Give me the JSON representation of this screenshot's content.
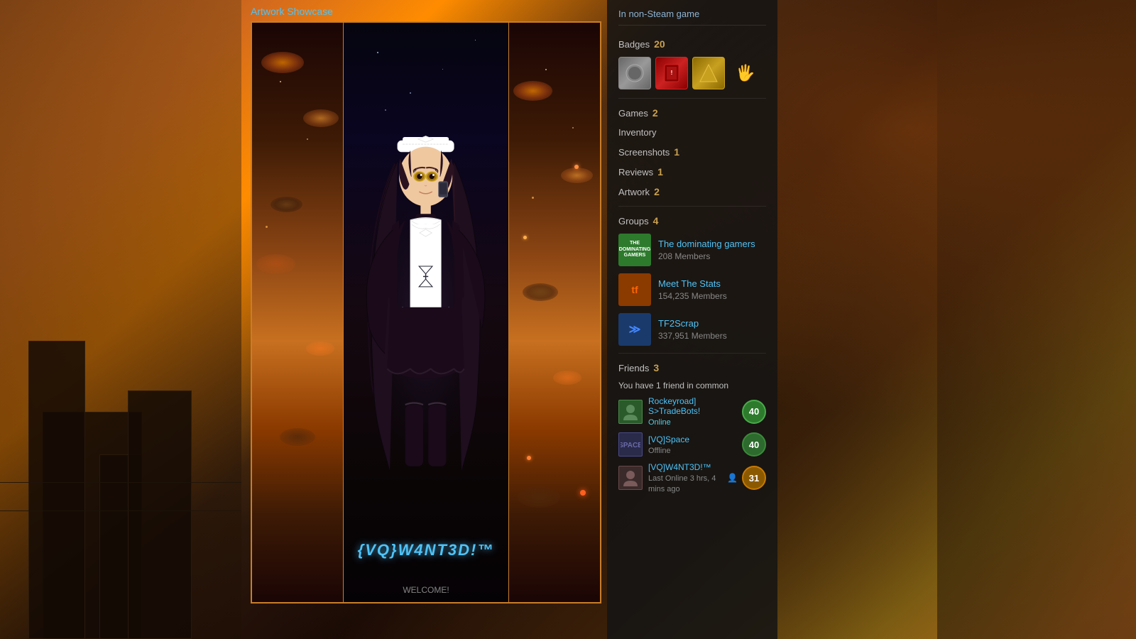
{
  "status": {
    "label": "In non-Steam game"
  },
  "showcase": {
    "title": "Artwork Showcase",
    "username": "{VQ}W4NT3D!™",
    "welcome": "WELCOME!"
  },
  "stats": {
    "badges_label": "Badges",
    "badges_count": "20",
    "games_label": "Games",
    "games_count": "2",
    "inventory_label": "Inventory",
    "screenshots_label": "Screenshots",
    "screenshots_count": "1",
    "reviews_label": "Reviews",
    "reviews_count": "1",
    "artwork_label": "Artwork",
    "artwork_count": "2"
  },
  "groups": {
    "label": "Groups",
    "count": "4",
    "items": [
      {
        "name": "The dominating gamers",
        "members": "208 Members",
        "icon_text": "THE\nDOMINATING\nGAMERS"
      },
      {
        "name": "Meet The Stats",
        "members": "154,235 Members",
        "icon_text": "tf"
      },
      {
        "name": "TF2Scrap",
        "members": "337,951 Members",
        "icon_text": "≫"
      }
    ]
  },
  "friends": {
    "label": "Friends",
    "count": "3",
    "common_text": "You have",
    "common_count": "1 friend",
    "common_suffix": "in common",
    "items": [
      {
        "name": "Rockeyroad] S>TradeBots!",
        "status": "Online",
        "status_type": "online",
        "level": "40",
        "level_type": "green"
      },
      {
        "name": "[VQ]Space",
        "status": "Offline",
        "status_type": "offline",
        "level": "40",
        "level_type": "green2"
      },
      {
        "name": "[VQ]W4NT3D!™",
        "status": "Last Online 3 hrs, 4 mins ago",
        "status_type": "last-online",
        "level": "31",
        "level_type": "orange",
        "mutual": true
      }
    ]
  }
}
